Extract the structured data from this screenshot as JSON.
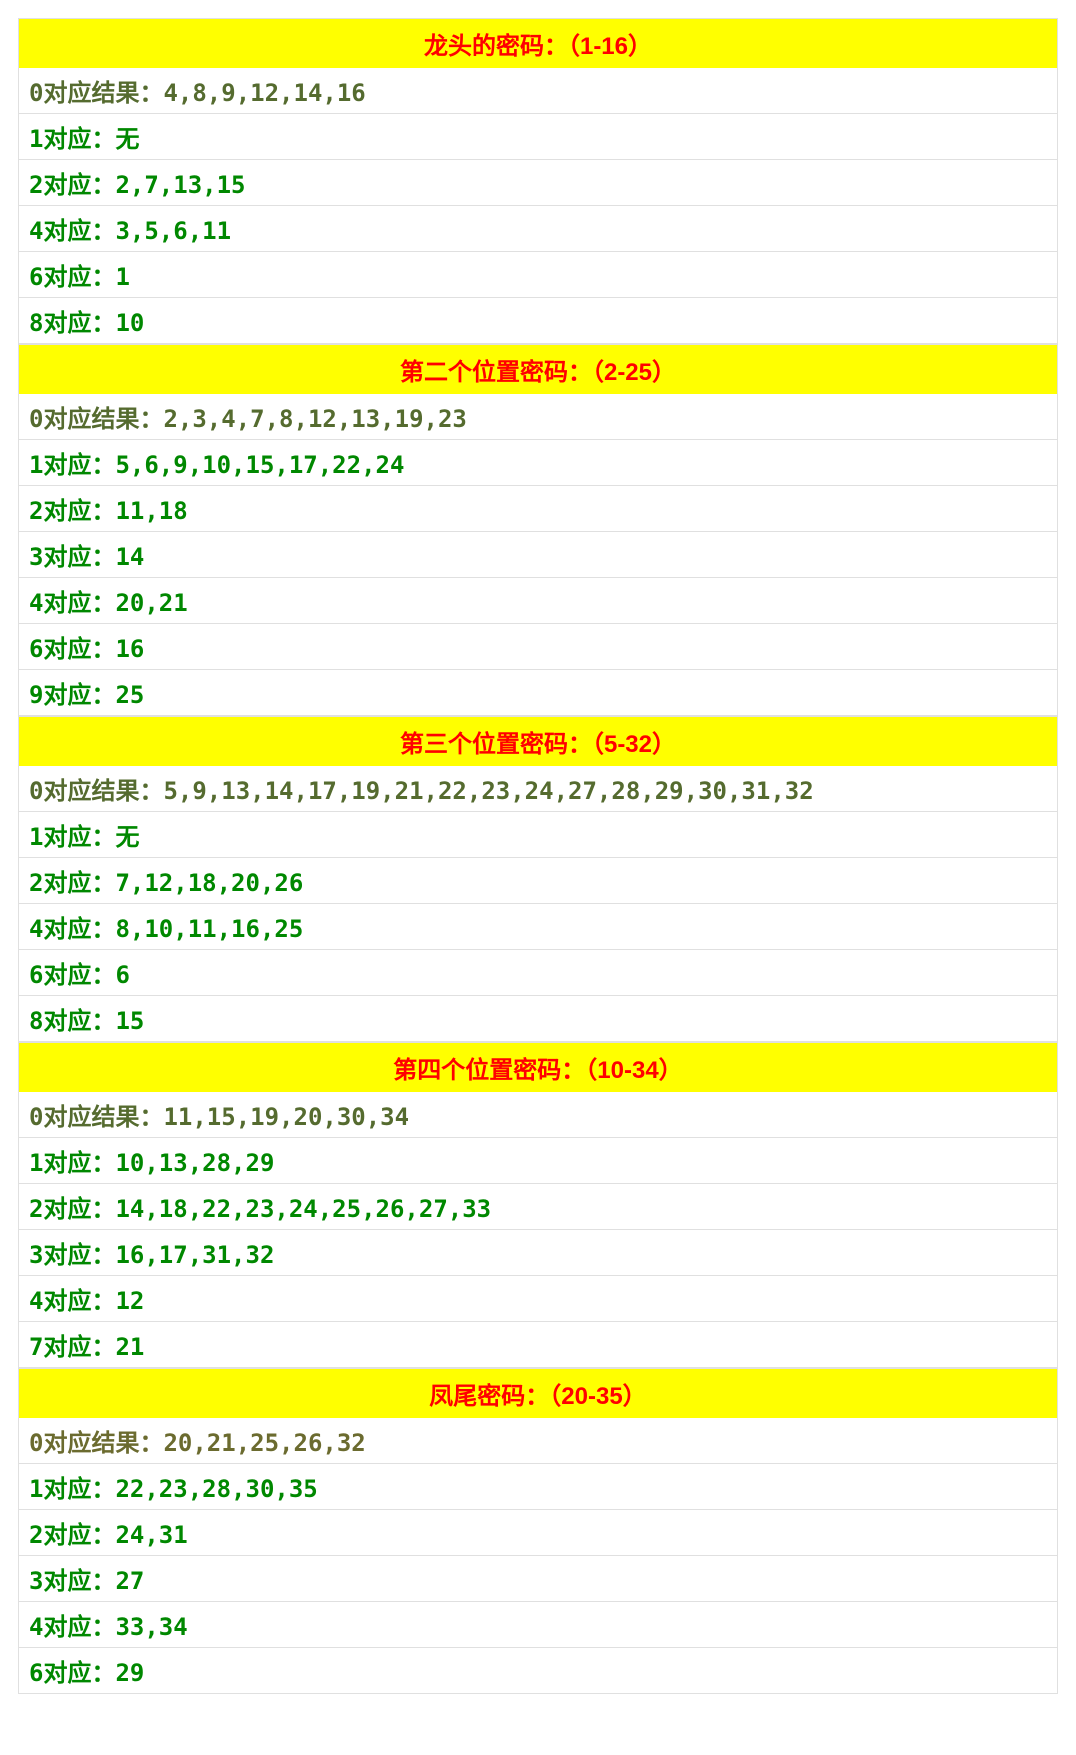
{
  "sections": [
    {
      "title": "龙头的密码：（1-16）",
      "rows": [
        "0对应结果：4,8,9,12,14,16",
        "1对应：无",
        "2对应：2,7,13,15",
        "4对应：3,5,6,11",
        "6对应：1",
        "8对应：10"
      ]
    },
    {
      "title": "第二个位置密码：（2-25）",
      "rows": [
        "0对应结果：2,3,4,7,8,12,13,19,23",
        "1对应：5,6,9,10,15,17,22,24",
        "2对应：11,18",
        "3对应：14",
        "4对应：20,21",
        "6对应：16",
        "9对应：25"
      ]
    },
    {
      "title": "第三个位置密码：（5-32）",
      "rows": [
        "0对应结果：5,9,13,14,17,19,21,22,23,24,27,28,29,30,31,32",
        "1对应：无",
        "2对应：7,12,18,20,26",
        "4对应：8,10,11,16,25",
        "6对应：6",
        "8对应：15"
      ]
    },
    {
      "title": "第四个位置密码：（10-34）",
      "rows": [
        "0对应结果：11,15,19,20,30,34",
        "1对应：10,13,28,29",
        "2对应：14,18,22,23,24,25,26,27,33",
        "3对应：16,17,31,32",
        "4对应：12",
        "7对应：21"
      ]
    },
    {
      "title": "凤尾密码：（20-35）",
      "rows": [
        "0对应结果：20,21,25,26,32",
        "1对应：22,23,28,30,35",
        "2对应：24,31",
        "3对应：27",
        "4对应：33,34",
        "6对应：29"
      ]
    }
  ]
}
